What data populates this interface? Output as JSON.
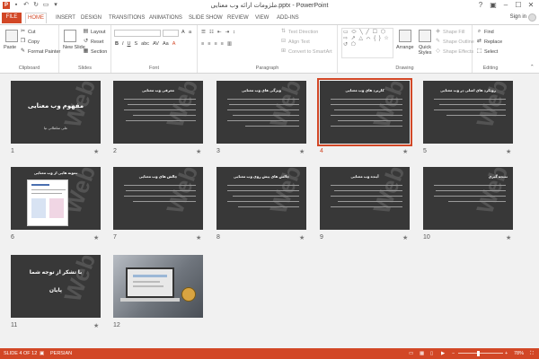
{
  "window": {
    "title": "ملزومات ارائه وب معنایی.pptx - PowerPoint",
    "sign_in": "Sign in"
  },
  "tabs": [
    "FILE",
    "HOME",
    "INSERT",
    "DESIGN",
    "TRANSITIONS",
    "ANIMATIONS",
    "SLIDE SHOW",
    "REVIEW",
    "VIEW",
    "ADD-INS"
  ],
  "ribbon": {
    "clipboard": {
      "paste": "Paste",
      "cut": "Cut",
      "copy": "Copy",
      "format_painter": "Format Painter",
      "label": "Clipboard"
    },
    "slides": {
      "new_slide": "New Slide",
      "layout": "Layout",
      "reset": "Reset",
      "section": "Section",
      "label": "Slides"
    },
    "font": {
      "label": "Font"
    },
    "paragraph": {
      "text_direction": "Text Direction",
      "align_text": "Align Text",
      "convert_smartart": "Convert to SmartArt",
      "label": "Paragraph"
    },
    "drawing": {
      "arrange": "Arrange",
      "quick_styles": "Quick Styles",
      "shape_fill": "Shape Fill",
      "shape_outline": "Shape Outline",
      "shape_effects": "Shape Effects",
      "label": "Drawing",
      "shapes_glyphs": "▭ ⬭ ╲ ╱ ☐ ⬡ ⇨ ↗ △ ⌒ { } ☆ ↺ ⬠"
    },
    "editing": {
      "find": "Find",
      "replace": "Replace",
      "select": "Select",
      "label": "Editing"
    }
  },
  "slides": [
    {
      "number": "1",
      "title": "مفهوم وب معنایی",
      "subtitle": "علی سلطانی نیا"
    },
    {
      "number": "2",
      "title": "معرفی وب معنایی"
    },
    {
      "number": "3",
      "title": "ویژگی های وب معنایی"
    },
    {
      "number": "4",
      "title": "کاربرد های وب معنایی"
    },
    {
      "number": "5",
      "title": "رویکرد های اصلی در وب معنایی"
    },
    {
      "number": "6",
      "title": "نمونه هایی از وب معنایی"
    },
    {
      "number": "7",
      "title": "چالش های وب معنایی"
    },
    {
      "number": "8",
      "title": "چالش های پیش روی وب معنایی"
    },
    {
      "number": "9",
      "title": "آینده وب معنایی"
    },
    {
      "number": "10",
      "title": "نتیجه گیری"
    },
    {
      "number": "11",
      "title": "با تشکر از توجه شما",
      "subtitle": "پایان"
    },
    {
      "number": "12",
      "title": ""
    }
  ],
  "star_glyph": "★",
  "status": {
    "slide_info": "SLIDE 4 OF 12",
    "language": "PERSIAN",
    "zoom": "78%"
  },
  "colors": {
    "accent": "#d24726",
    "slide_bg": "#383838"
  }
}
